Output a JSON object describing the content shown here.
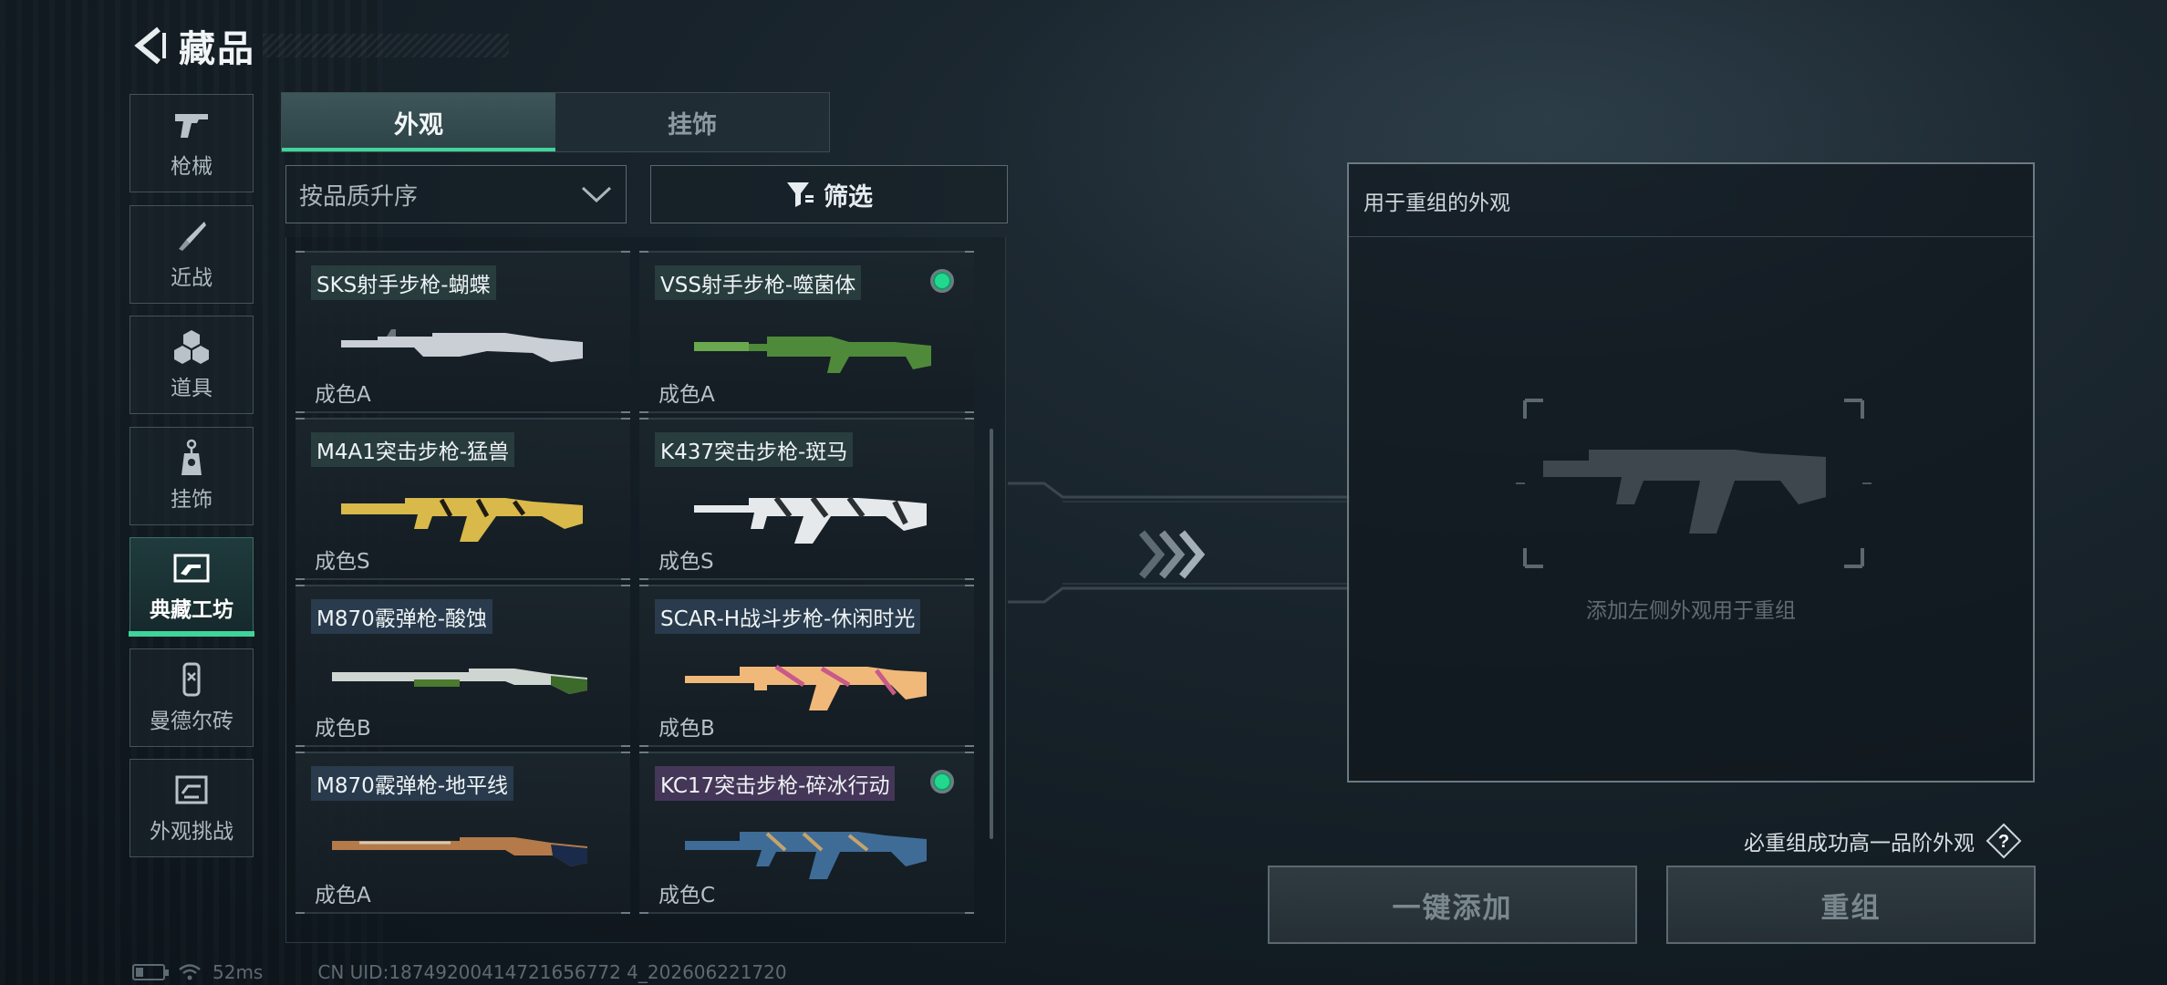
{
  "header": {
    "title": "藏品"
  },
  "sidebar": {
    "items": [
      {
        "label": "枪械",
        "icon": "pistol-icon"
      },
      {
        "label": "近战",
        "icon": "knife-icon"
      },
      {
        "label": "道具",
        "icon": "items-icon"
      },
      {
        "label": "挂饰",
        "icon": "charm-icon"
      },
      {
        "label": "典藏工坊",
        "icon": "workshop-icon",
        "active": true
      },
      {
        "label": "曼德尔砖",
        "icon": "mandel-brick-icon"
      },
      {
        "label": "外观挑战",
        "icon": "challenge-icon"
      }
    ]
  },
  "tabs": [
    {
      "label": "外观",
      "active": true
    },
    {
      "label": "挂饰",
      "active": false
    }
  ],
  "sort": {
    "value": "按品质升序"
  },
  "filter": {
    "label": "筛选"
  },
  "skins": [
    {
      "name": "SKS射手步枪-蝴蝶",
      "grade": "成色A",
      "equipped": false,
      "tag": "teal"
    },
    {
      "name": "VSS射手步枪-噬菌体",
      "grade": "成色A",
      "equipped": true,
      "tag": "teal"
    },
    {
      "name": "M4A1突击步枪-猛兽",
      "grade": "成色S",
      "equipped": false,
      "tag": "teal"
    },
    {
      "name": "K437突击步枪-斑马",
      "grade": "成色S",
      "equipped": false,
      "tag": "teal"
    },
    {
      "name": "M870霰弹枪-酸蚀",
      "grade": "成色B",
      "equipped": false,
      "tag": "blue"
    },
    {
      "name": "SCAR-H战斗步枪-休闲时光",
      "grade": "成色B",
      "equipped": false,
      "tag": "blue"
    },
    {
      "name": "M870霰弹枪-地平线",
      "grade": "成色A",
      "equipped": false,
      "tag": "blue"
    },
    {
      "name": "KC17突击步枪-碎冰行动",
      "grade": "成色C",
      "equipped": true,
      "tag": "purple"
    }
  ],
  "recombine": {
    "title": "用于重组的外观",
    "placeholder": "添加左侧外观用于重组"
  },
  "hint": "必重组成功高一品阶外观",
  "buttons": {
    "add_all": "一键添加",
    "recombine": "重组"
  },
  "status": {
    "ping": "52ms",
    "uid": "CN UID:18749200414721656772 4_202606221720"
  },
  "colors": {
    "accent": "#3fd49a",
    "equipped_dot": "#22d88f"
  }
}
